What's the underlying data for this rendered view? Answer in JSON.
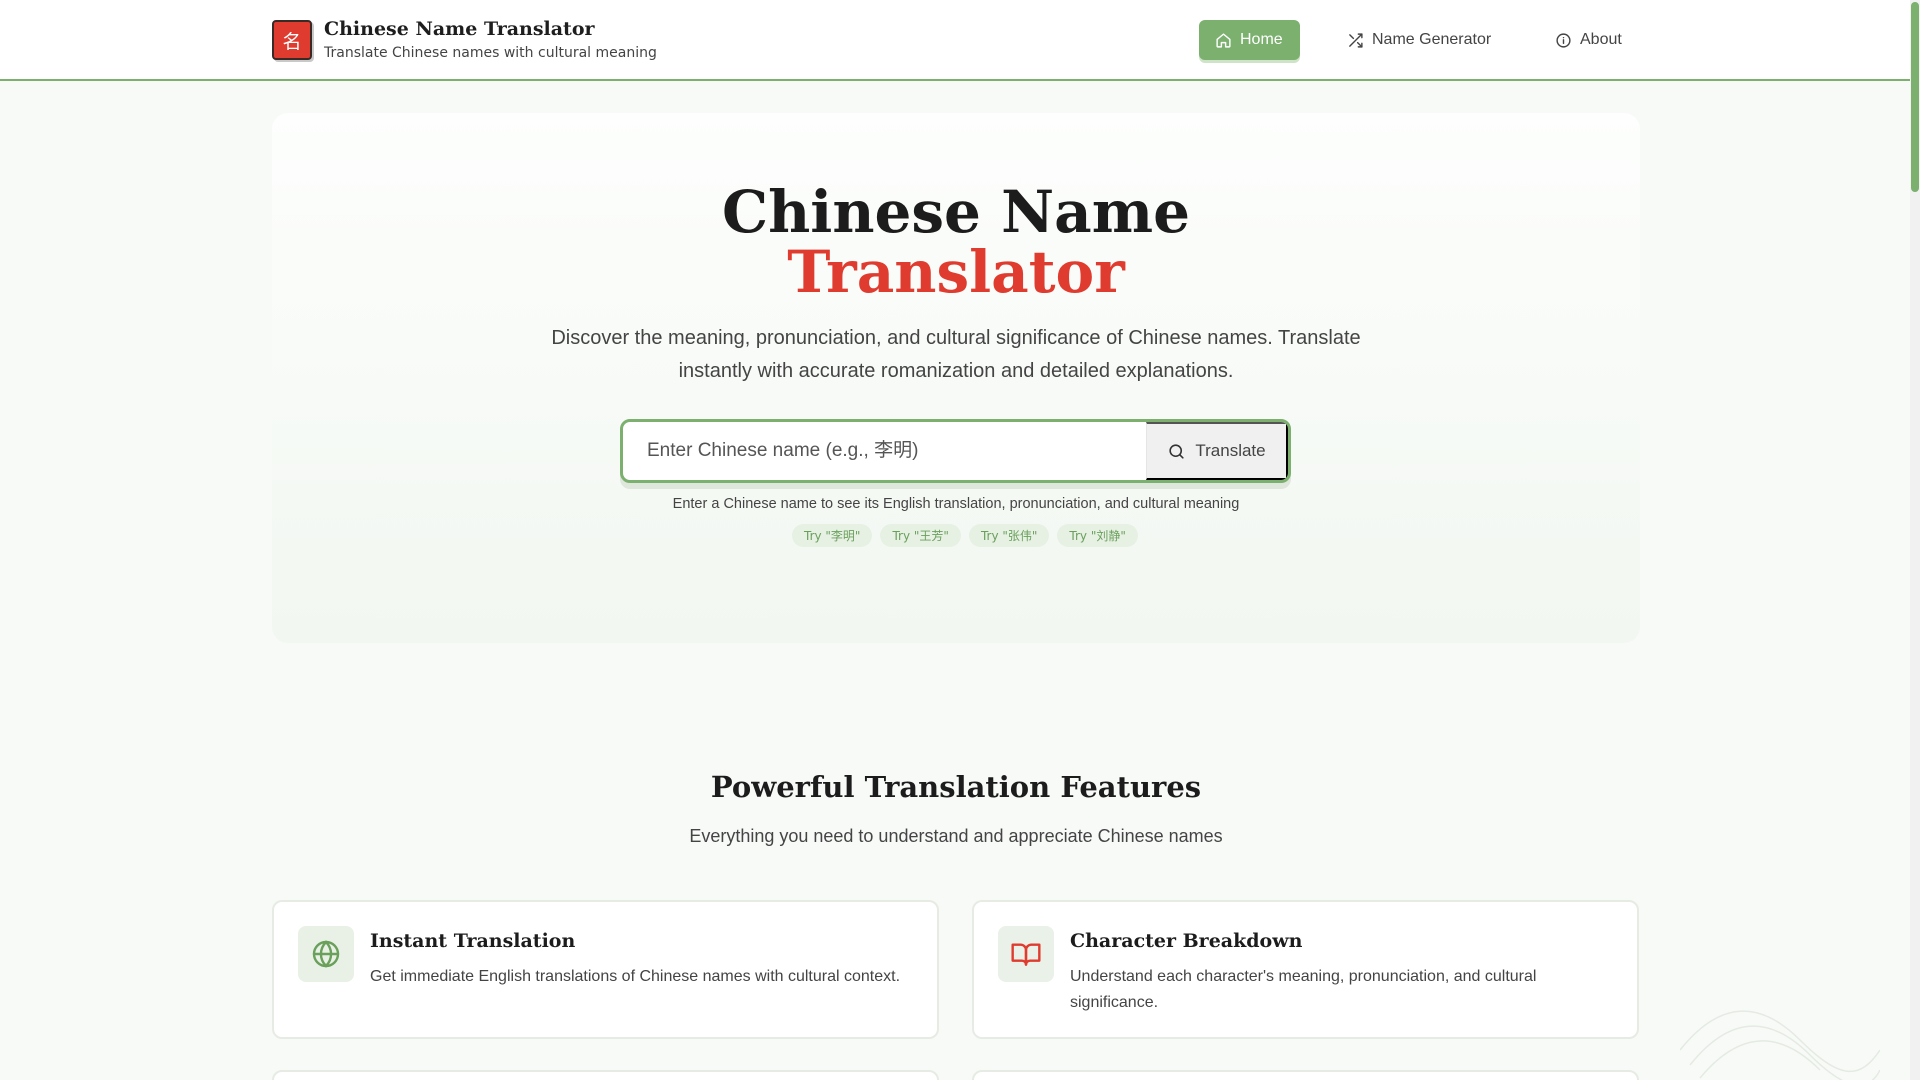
{
  "header": {
    "logo_char": "名",
    "title": "Chinese Name Translator",
    "subtitle": "Translate Chinese names with cultural meaning",
    "nav": [
      {
        "label": "Home",
        "icon": "home-icon",
        "active": true
      },
      {
        "label": "Name Generator",
        "icon": "shuffle-icon",
        "active": false
      },
      {
        "label": "About",
        "icon": "info-icon",
        "active": false
      }
    ]
  },
  "hero": {
    "title_line1": "Chinese Name",
    "title_line2": "Translator",
    "description": "Discover the meaning, pronunciation, and cultural significance of Chinese names. Translate instantly with accurate romanization and detailed explanations.",
    "search": {
      "placeholder": "Enter Chinese name (e.g., 李明)",
      "value": "",
      "button_label": "Translate"
    },
    "hint": "Enter a Chinese name to see its English translation, pronunciation, and cultural meaning",
    "examples": [
      "Try \"李明\"",
      "Try \"王芳\"",
      "Try \"张伟\"",
      "Try \"刘静\""
    ]
  },
  "features": {
    "title": "Powerful Translation Features",
    "subtitle": "Everything you need to understand and appreciate Chinese names",
    "cards": [
      {
        "title": "Instant Translation",
        "description": "Get immediate English translations of Chinese names with cultural context.",
        "icon": "globe-icon"
      },
      {
        "title": "Character Breakdown",
        "description": "Understand each character's meaning, pronunciation, and cultural significance.",
        "icon": "book-open-icon"
      }
    ]
  },
  "colors": {
    "accent_green": "#7bb06e",
    "accent_red": "#e03b2f",
    "background": "#f8faf8"
  }
}
